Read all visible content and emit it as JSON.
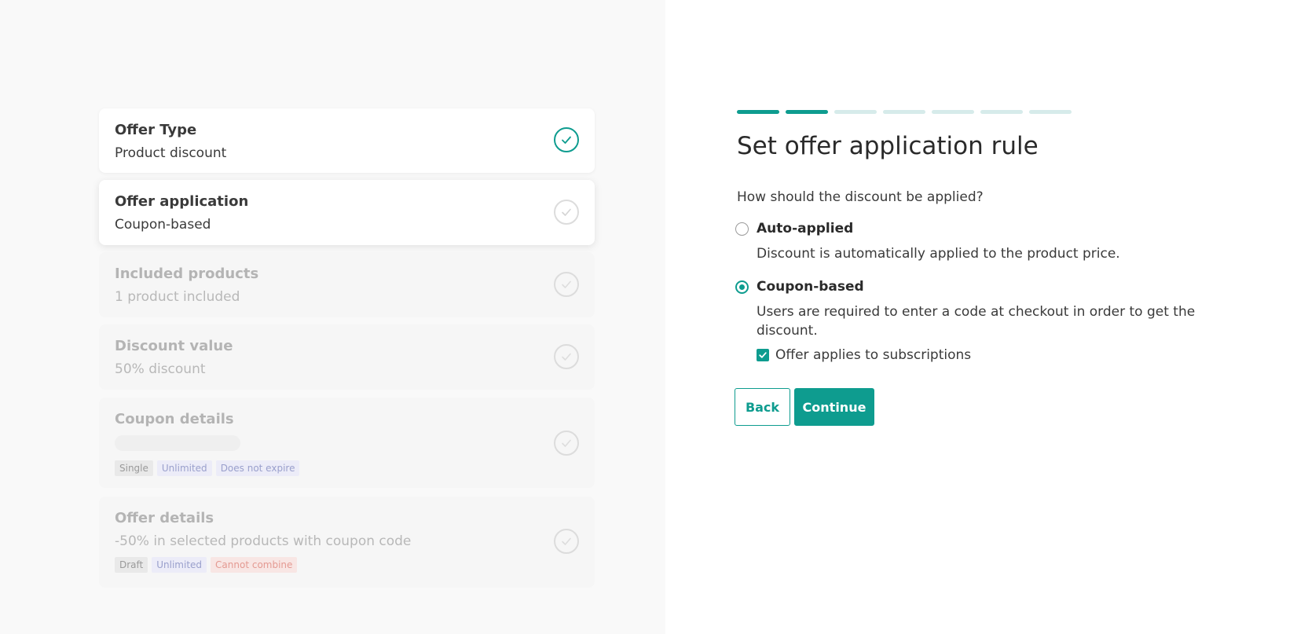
{
  "steps": [
    {
      "title": "Offer Type",
      "subtitle": "Product discount",
      "status": "done"
    },
    {
      "title": "Offer application",
      "subtitle": "Coupon-based",
      "status": "current"
    },
    {
      "title": "Included products",
      "subtitle": "1 product included",
      "status": "pending"
    },
    {
      "title": "Discount value",
      "subtitle": "50% discount",
      "status": "pending"
    },
    {
      "title": "Coupon details",
      "subtitle": "",
      "status": "pending",
      "tags": [
        "Single",
        "Unlimited",
        "Does not expire"
      ]
    },
    {
      "title": "Offer details",
      "subtitle": "-50% in selected products with coupon code",
      "status": "pending",
      "tags": [
        "Draft",
        "Unlimited",
        "Cannot combine"
      ]
    }
  ],
  "progress": {
    "total": 7,
    "completed": 2
  },
  "form": {
    "title": "Set offer application rule",
    "question": "How should the discount be applied?",
    "options": [
      {
        "label": "Auto-applied",
        "description": "Discount is automatically applied to the product price.",
        "selected": false
      },
      {
        "label": "Coupon-based",
        "description": "Users are required to enter a code at checkout in order to get the discount.",
        "selected": true
      }
    ],
    "subscription_checkbox": {
      "label": "Offer applies to subscriptions",
      "checked": true
    },
    "back_label": "Back",
    "continue_label": "Continue"
  },
  "colors": {
    "accent": "#0e9c8f",
    "progress_inactive": "#d6ebea",
    "tag_gray": "#e9e9e9",
    "tag_blue": "#ececf8",
    "tag_red": "#f8e6e4"
  },
  "icons": {
    "step_status": "check-circle-icon",
    "checkbox": "check-icon"
  }
}
